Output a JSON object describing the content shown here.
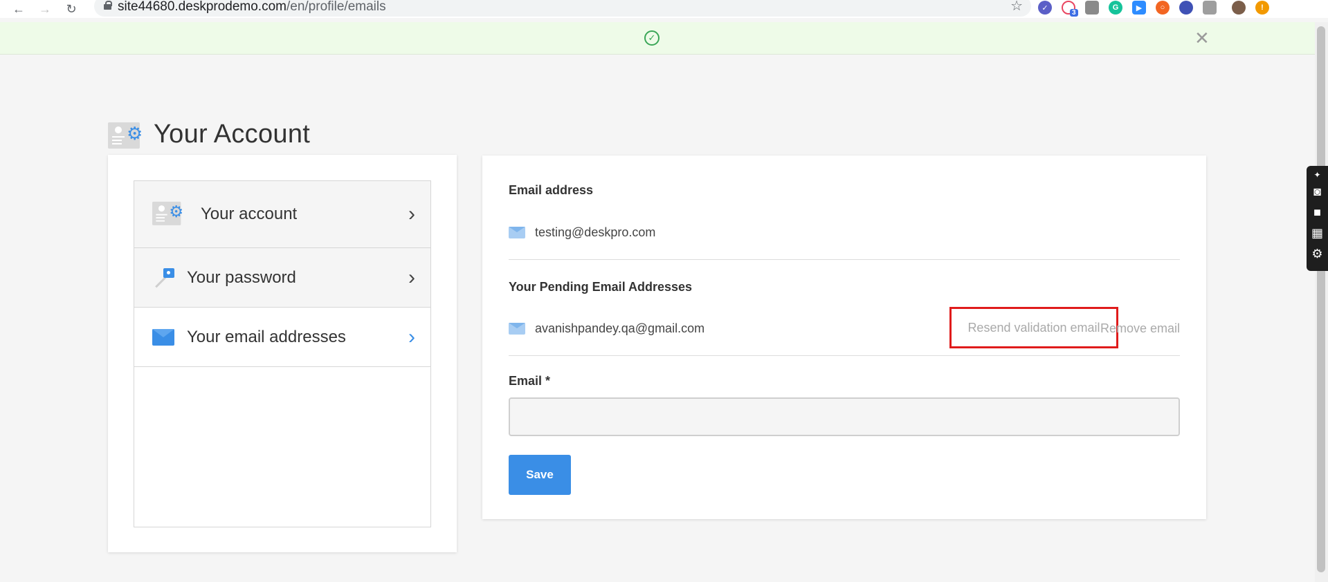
{
  "browser": {
    "url_host": "site44680.deskprodemo.com",
    "url_path": "/en/profile/emails",
    "extension_badge": "3"
  },
  "banner": {
    "close_glyph": "✕"
  },
  "page": {
    "title": "Your Account"
  },
  "sidebar": {
    "items": [
      {
        "label": "Your account",
        "icon": "account-settings-icon"
      },
      {
        "label": "Your password",
        "icon": "key-icon"
      },
      {
        "label": "Your email addresses",
        "icon": "envelope-icon",
        "active": true
      }
    ]
  },
  "emails": {
    "primary_heading": "Email address",
    "primary_email": "testing@deskpro.com",
    "pending_heading": "Your Pending Email Addresses",
    "pending_email": "avanishpandey.qa@gmail.com",
    "resend_label": "Resend validation email",
    "remove_label": "Remove email",
    "input_label": "Email *",
    "input_value": "",
    "save_label": "Save"
  },
  "colors": {
    "accent": "#3a8ee6",
    "success_bg": "#eefbe8",
    "highlight": "#e01b1b"
  }
}
